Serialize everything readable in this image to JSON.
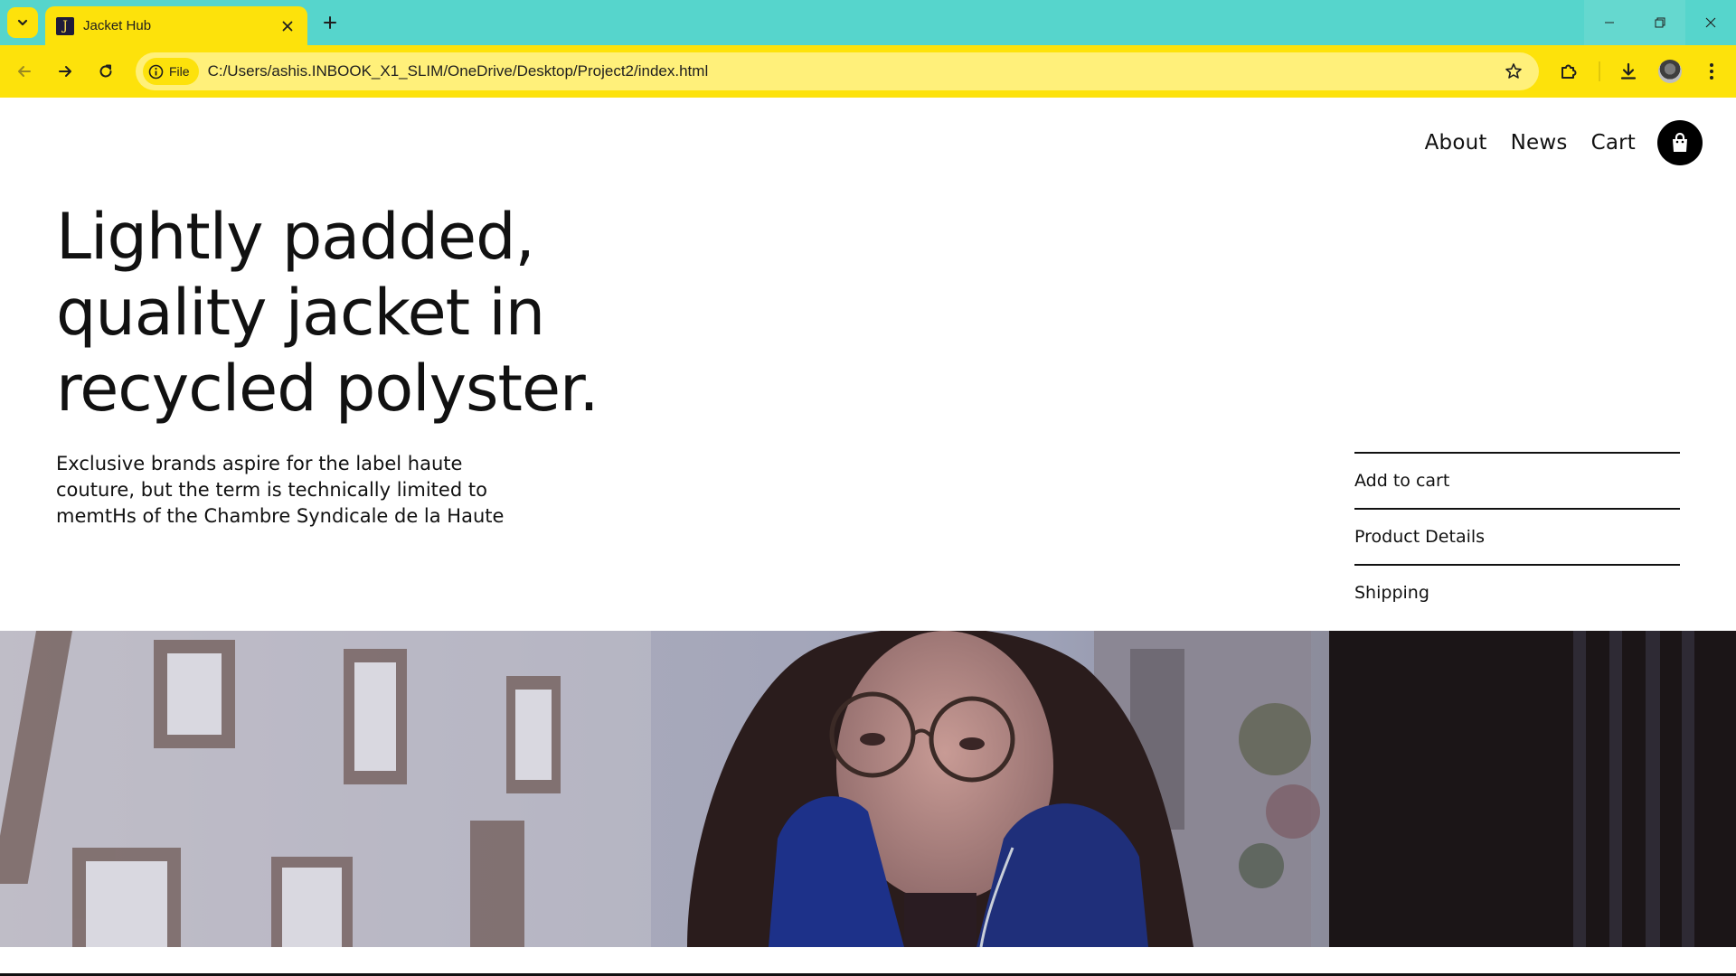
{
  "browser": {
    "tab": {
      "favicon_letter": "J",
      "title": "Jacket Hub"
    },
    "address_bar": {
      "site_chip_label": "File",
      "url": "C:/Users/ashis.INBOOK_X1_SLIM/OneDrive/Desktop/Project2/index.html"
    },
    "icons": {
      "tab_search": "chevron-down-icon",
      "close_tab": "close-icon",
      "new_tab": "plus-icon",
      "back": "arrow-left-icon",
      "forward": "arrow-right-icon",
      "reload": "reload-icon",
      "info": "info-icon",
      "bookmark": "star-icon",
      "extensions": "puzzle-icon",
      "downloads": "download-icon",
      "menu": "kebab-menu-icon",
      "minimize": "minimize-icon",
      "restore": "restore-icon",
      "close_window": "close-icon"
    },
    "colors": {
      "tabstrip": "#56d5cc",
      "toolbar": "#fde20b",
      "omnibox": "#fff07a"
    }
  },
  "site": {
    "nav": {
      "items": [
        "About",
        "News",
        "Cart"
      ],
      "bag_icon": "shopping-bag-icon"
    },
    "hero": {
      "title_lines": [
        "Lightly padded,",
        "quality jacket in",
        "recycled polyster."
      ],
      "description_lines": [
        "Exclusive brands aspire for the label haute",
        "couture, but the term is technically limited to",
        "memtHs of the Chambre Syndicale de la Haute"
      ]
    },
    "actions": [
      "Add to cart",
      "Product Details",
      "Shipping"
    ],
    "image": {
      "subject": "woman-with-glasses-in-blue-jacket-photo"
    }
  }
}
